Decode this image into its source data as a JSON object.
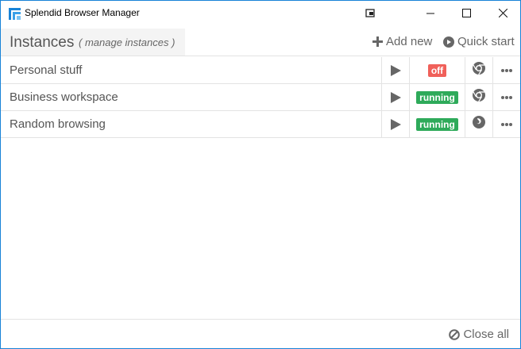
{
  "window": {
    "title": "Splendid Browser Manager"
  },
  "header": {
    "title": "Instances",
    "subtitle": "( manage instances )",
    "add_new": "Add new",
    "quick_start": "Quick start"
  },
  "instances": [
    {
      "name": "Personal stuff",
      "status": "off",
      "status_color": "#f0605a",
      "browser": "chrome-icon"
    },
    {
      "name": "Business workspace",
      "status": "running",
      "status_color": "#2eaa5a",
      "browser": "chrome-icon"
    },
    {
      "name": "Random browsing",
      "status": "running",
      "status_color": "#2eaa5a",
      "browser": "firefox-icon"
    }
  ],
  "footer": {
    "close_all": "Close all"
  },
  "colors": {
    "accent": "#1883d7",
    "icon": "#666666"
  }
}
